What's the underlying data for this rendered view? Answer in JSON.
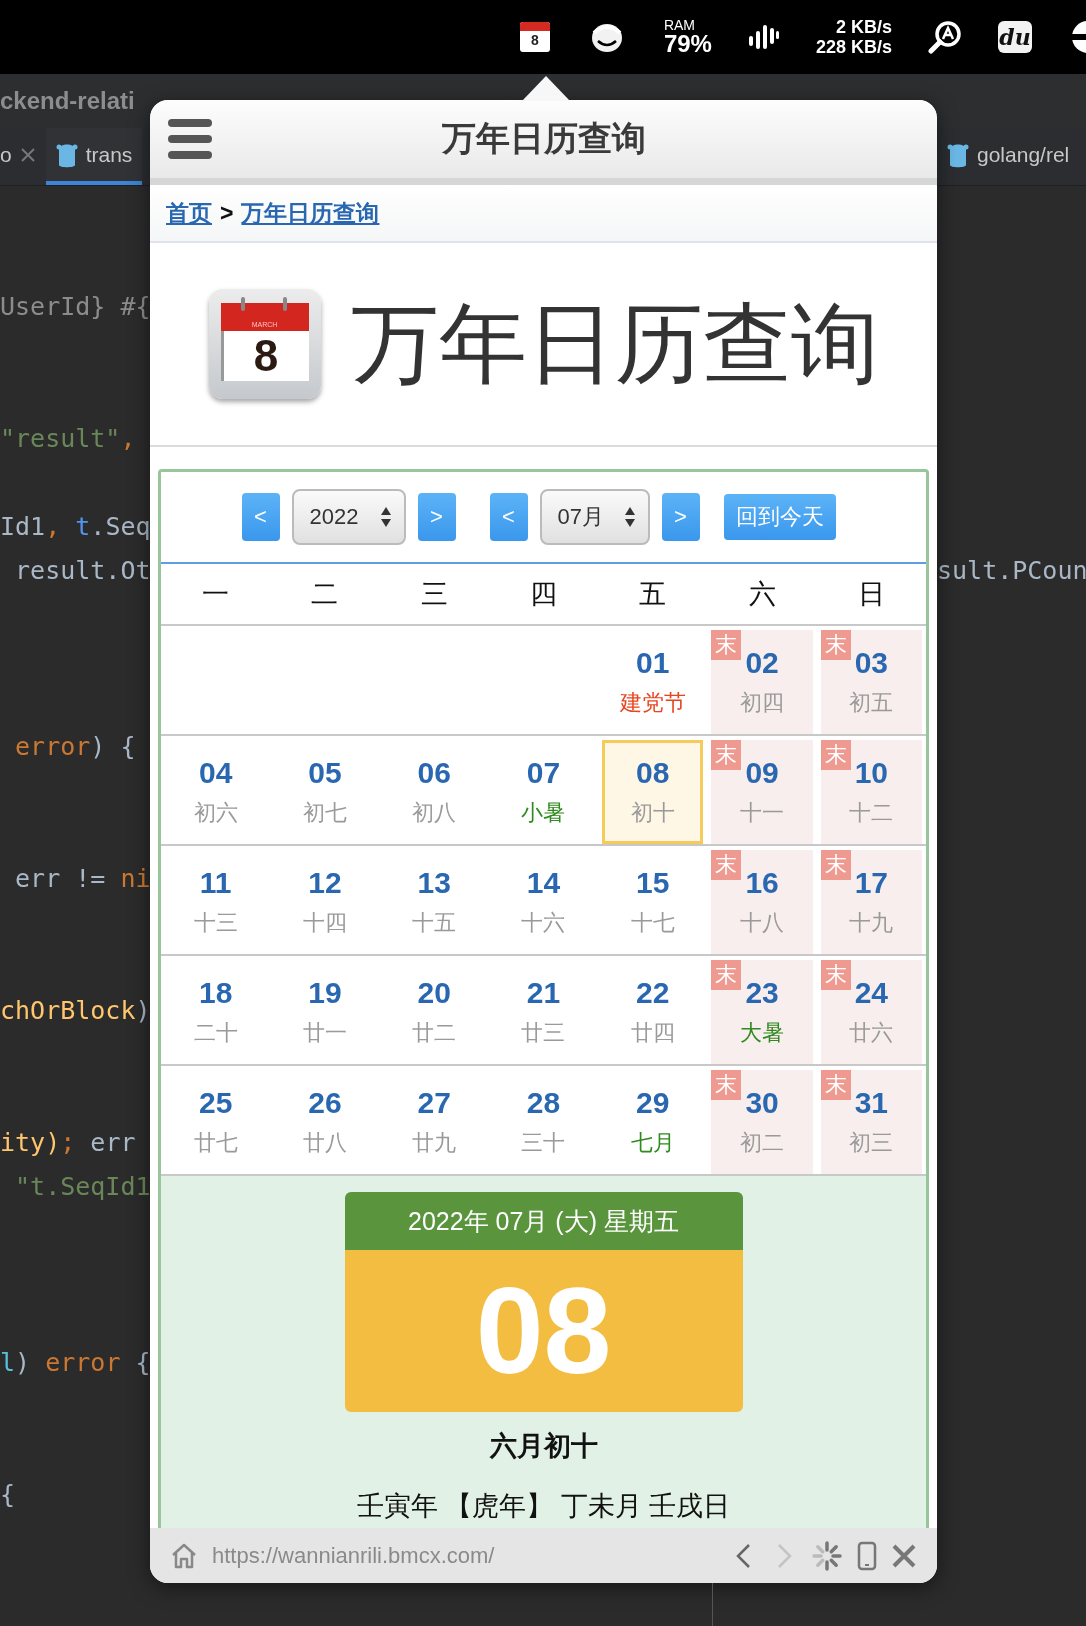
{
  "menubar": {
    "calendar_day": "8",
    "ram_label": "RAM",
    "ram_value": "79%",
    "net_up": "2 KB/s",
    "net_down": "228 KB/s",
    "app_label": "du"
  },
  "editor": {
    "title": "ckend-relati",
    "tabs_left": [
      {
        "label": "o",
        "kind": "closable",
        "selected": false
      },
      {
        "label": "trans",
        "kind": "file",
        "selected": true
      }
    ],
    "tabs_right": [
      {
        "label": "golang/rel",
        "kind": "file",
        "selected": false
      }
    ],
    "code_left": [
      [
        {
          "text": "UserId} #{",
          "kind": "muted"
        }
      ],
      [
        {
          "text": "\"result\"",
          "kind": "string"
        },
        {
          "text": ",",
          "kind": "keyword"
        }
      ],
      [
        {
          "text": "Id1",
          "kind": "plain"
        },
        {
          "text": ", ",
          "kind": "keyword"
        },
        {
          "text": "t",
          "kind": "member"
        },
        {
          "text": ".Seq",
          "kind": "plain"
        }
      ],
      [
        {
          "text": " result.Ot",
          "kind": "plain"
        }
      ],
      [
        {
          "text": " error",
          "kind": "keyword"
        },
        {
          "text": ") {",
          "kind": "plain"
        }
      ],
      [
        {
          "text": " err != ",
          "kind": "plain"
        },
        {
          "text": "ni",
          "kind": "keyword"
        }
      ],
      [
        {
          "text": "chOrBlock",
          "kind": "func"
        },
        {
          "text": ")",
          "kind": "plain"
        }
      ],
      [
        {
          "text": "ity)",
          "kind": "func"
        },
        {
          "text": "; ",
          "kind": "keyword"
        },
        {
          "text": "err",
          "kind": "plain"
        }
      ],
      [
        {
          "text": " \"t.SeqId1",
          "kind": "string"
        }
      ],
      [
        {
          "text": "l",
          "kind": "param"
        },
        {
          "text": ") ",
          "kind": "plain"
        },
        {
          "text": "error",
          "kind": "keyword"
        },
        {
          "text": " {",
          "kind": "plain"
        }
      ],
      [
        {
          "text": "{",
          "kind": "plain"
        }
      ]
    ],
    "code_right": [
      [
        {
          "text": "sult.PCoun",
          "kind": "plain"
        }
      ]
    ]
  },
  "popup": {
    "title": "万年日历查询",
    "breadcrumb": [
      {
        "label": "首页"
      },
      {
        "label": "万年日历查询"
      }
    ],
    "breadcrumb_separator": ">",
    "logo": {
      "month": "MARCH",
      "day": "8"
    },
    "heading": "万年日历查询",
    "calendar": {
      "year_prev": "<",
      "year": "2022",
      "year_next": ">",
      "month_prev": "<",
      "month": "07月",
      "month_next": ">",
      "today_button": "回到今天",
      "weekdays": [
        "一",
        "二",
        "三",
        "四",
        "五",
        "六",
        "日"
      ],
      "weeks": [
        {
          "days": [
            {
              "kind": "blank"
            },
            {
              "kind": "blank"
            },
            {
              "kind": "blank"
            },
            {
              "kind": "blank"
            },
            {
              "kind": "day",
              "date": "01",
              "lunar": "建党节",
              "color": "#e8451e",
              "weekend": false,
              "selected": false
            },
            {
              "kind": "day",
              "date": "02",
              "lunar": "初四",
              "color": "#9a9a9a",
              "weekend": true,
              "badge": "末",
              "selected": false
            },
            {
              "kind": "day",
              "date": "03",
              "lunar": "初五",
              "color": "#9a9a9a",
              "weekend": true,
              "badge": "末",
              "selected": false
            }
          ]
        },
        {
          "days": [
            {
              "kind": "day",
              "date": "04",
              "lunar": "初六",
              "color": "#9a9a9a",
              "weekend": false,
              "selected": false
            },
            {
              "kind": "day",
              "date": "05",
              "lunar": "初七",
              "color": "#9a9a9a",
              "weekend": false,
              "selected": false
            },
            {
              "kind": "day",
              "date": "06",
              "lunar": "初八",
              "color": "#9a9a9a",
              "weekend": false,
              "selected": false
            },
            {
              "kind": "day",
              "date": "07",
              "lunar": "小暑",
              "color": "#2f8a1f",
              "weekend": false,
              "selected": false
            },
            {
              "kind": "day",
              "date": "08",
              "lunar": "初十",
              "color": "#9a9a9a",
              "weekend": false,
              "selected": true
            },
            {
              "kind": "day",
              "date": "09",
              "lunar": "十一",
              "color": "#9a9a9a",
              "weekend": true,
              "badge": "末",
              "selected": false
            },
            {
              "kind": "day",
              "date": "10",
              "lunar": "十二",
              "color": "#9a9a9a",
              "weekend": true,
              "badge": "末",
              "selected": false
            }
          ]
        },
        {
          "days": [
            {
              "kind": "day",
              "date": "11",
              "lunar": "十三",
              "color": "#9a9a9a",
              "weekend": false,
              "selected": false
            },
            {
              "kind": "day",
              "date": "12",
              "lunar": "十四",
              "color": "#9a9a9a",
              "weekend": false,
              "selected": false
            },
            {
              "kind": "day",
              "date": "13",
              "lunar": "十五",
              "color": "#9a9a9a",
              "weekend": false,
              "selected": false
            },
            {
              "kind": "day",
              "date": "14",
              "lunar": "十六",
              "color": "#9a9a9a",
              "weekend": false,
              "selected": false
            },
            {
              "kind": "day",
              "date": "15",
              "lunar": "十七",
              "color": "#9a9a9a",
              "weekend": false,
              "selected": false
            },
            {
              "kind": "day",
              "date": "16",
              "lunar": "十八",
              "color": "#9a9a9a",
              "weekend": true,
              "badge": "末",
              "selected": false
            },
            {
              "kind": "day",
              "date": "17",
              "lunar": "十九",
              "color": "#9a9a9a",
              "weekend": true,
              "badge": "末",
              "selected": false
            }
          ]
        },
        {
          "days": [
            {
              "kind": "day",
              "date": "18",
              "lunar": "二十",
              "color": "#9a9a9a",
              "weekend": false,
              "selected": false
            },
            {
              "kind": "day",
              "date": "19",
              "lunar": "廿一",
              "color": "#9a9a9a",
              "weekend": false,
              "selected": false
            },
            {
              "kind": "day",
              "date": "20",
              "lunar": "廿二",
              "color": "#9a9a9a",
              "weekend": false,
              "selected": false
            },
            {
              "kind": "day",
              "date": "21",
              "lunar": "廿三",
              "color": "#9a9a9a",
              "weekend": false,
              "selected": false
            },
            {
              "kind": "day",
              "date": "22",
              "lunar": "廿四",
              "color": "#9a9a9a",
              "weekend": false,
              "selected": false
            },
            {
              "kind": "day",
              "date": "23",
              "lunar": "大暑",
              "color": "#2f8a1f",
              "weekend": true,
              "badge": "末",
              "selected": false
            },
            {
              "kind": "day",
              "date": "24",
              "lunar": "廿六",
              "color": "#9a9a9a",
              "weekend": true,
              "badge": "末",
              "selected": false
            }
          ]
        },
        {
          "days": [
            {
              "kind": "day",
              "date": "25",
              "lunar": "廿七",
              "color": "#9a9a9a",
              "weekend": false,
              "selected": false
            },
            {
              "kind": "day",
              "date": "26",
              "lunar": "廿八",
              "color": "#9a9a9a",
              "weekend": false,
              "selected": false
            },
            {
              "kind": "day",
              "date": "27",
              "lunar": "廿九",
              "color": "#9a9a9a",
              "weekend": false,
              "selected": false
            },
            {
              "kind": "day",
              "date": "28",
              "lunar": "三十",
              "color": "#9a9a9a",
              "weekend": false,
              "selected": false
            },
            {
              "kind": "day",
              "date": "29",
              "lunar": "七月",
              "color": "#2f8a1f",
              "weekend": false,
              "selected": false
            },
            {
              "kind": "day",
              "date": "30",
              "lunar": "初二",
              "color": "#9a9a9a",
              "weekend": true,
              "badge": "末",
              "selected": false
            },
            {
              "kind": "day",
              "date": "31",
              "lunar": "初三",
              "color": "#9a9a9a",
              "weekend": true,
              "badge": "末",
              "selected": false
            }
          ]
        }
      ]
    },
    "summary": {
      "header": "2022年 07月 (大) 星期五",
      "day": "08",
      "lunar": "六月初十",
      "ganzhi": "壬寅年 【虎年】 丁未月 壬戌日"
    },
    "address_bar": {
      "url": "https://wannianrili.bmcx.com/",
      "back_disabled": false,
      "forward_disabled": true
    }
  }
}
